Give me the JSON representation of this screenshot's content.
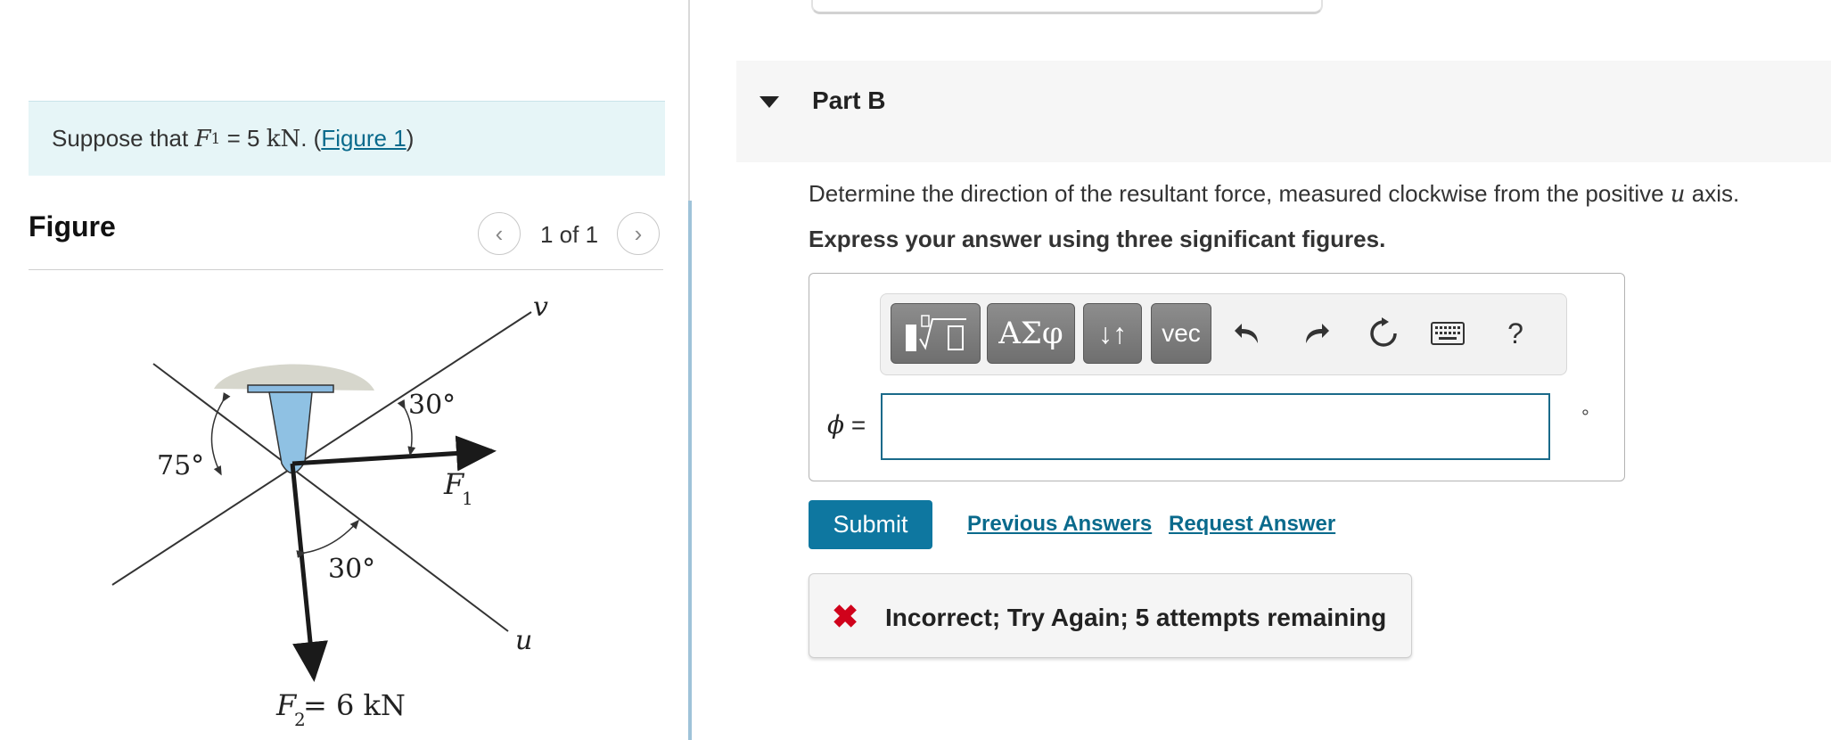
{
  "problem": {
    "prefix": "Suppose that",
    "var": "F",
    "sub": "1",
    "eq": "= 5",
    "unit": "kN",
    "tail": ". (",
    "link": "Figure 1",
    "close": ")"
  },
  "figure": {
    "title": "Figure",
    "pager": "1 of 1",
    "labels": {
      "v": "v",
      "u": "u",
      "angle_top": "30°",
      "angle_left": "75°",
      "angle_bottom": "30°",
      "f1": "F",
      "f1_sub": "1",
      "f2": "F",
      "f2_sub": "2",
      "f2_value": " = 6 kN"
    }
  },
  "partb": {
    "title": "Part B",
    "question_pre": "Determine the direction of the resultant force, measured clockwise from the positive",
    "question_var": "u",
    "question_post": "axis.",
    "instruction": "Express your answer using three significant figures."
  },
  "toolbar": {
    "greek": "ΑΣφ",
    "arrows": "↓↑",
    "vec": "vec",
    "help": "?"
  },
  "answer": {
    "label_var": "ϕ",
    "label_eq": " =",
    "value": "",
    "unit": "°"
  },
  "actions": {
    "submit": "Submit",
    "previous": "Previous Answers",
    "request": "Request Answer"
  },
  "feedback": {
    "icon": "✖",
    "text": "Incorrect; Try Again; 5 attempts remaining"
  },
  "colors": {
    "accent": "#0e77a0",
    "link": "#0a6a8c",
    "error": "#d0021b",
    "problem_bg": "#e6f5f7"
  }
}
